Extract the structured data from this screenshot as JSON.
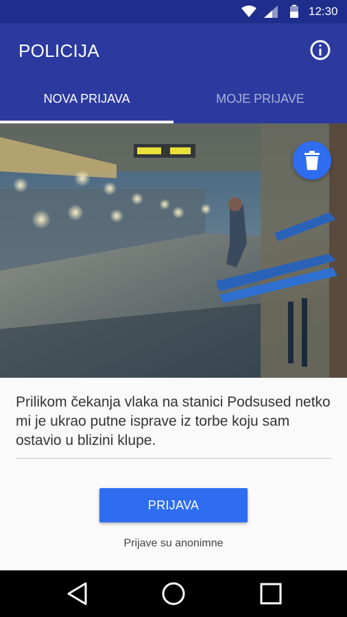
{
  "status_bar": {
    "time": "12:30",
    "icons": [
      "wifi-icon",
      "signal-icon",
      "battery-icon"
    ]
  },
  "app_bar": {
    "title": "POLICIJA",
    "info_icon": "info-icon",
    "background_color": "#2c3aa0"
  },
  "tabs": [
    {
      "label": "NOVA PRIJAVA",
      "active": true
    },
    {
      "label": "MOJE PRIJAVE",
      "active": false
    }
  ],
  "photo": {
    "delete_icon": "trash-icon",
    "fab_color": "#2f6df0"
  },
  "report": {
    "description": "Prilikom čekanja vlaka na stanici Podsused netko mi je ukrao putne isprave iz torbe koju sam ostavio u blizini klupe.",
    "submit_label": "PRIJAVA",
    "note": "Prijave su anonimne"
  },
  "nav_bar": {
    "icons": [
      "back-icon",
      "home-icon",
      "recents-icon"
    ]
  }
}
